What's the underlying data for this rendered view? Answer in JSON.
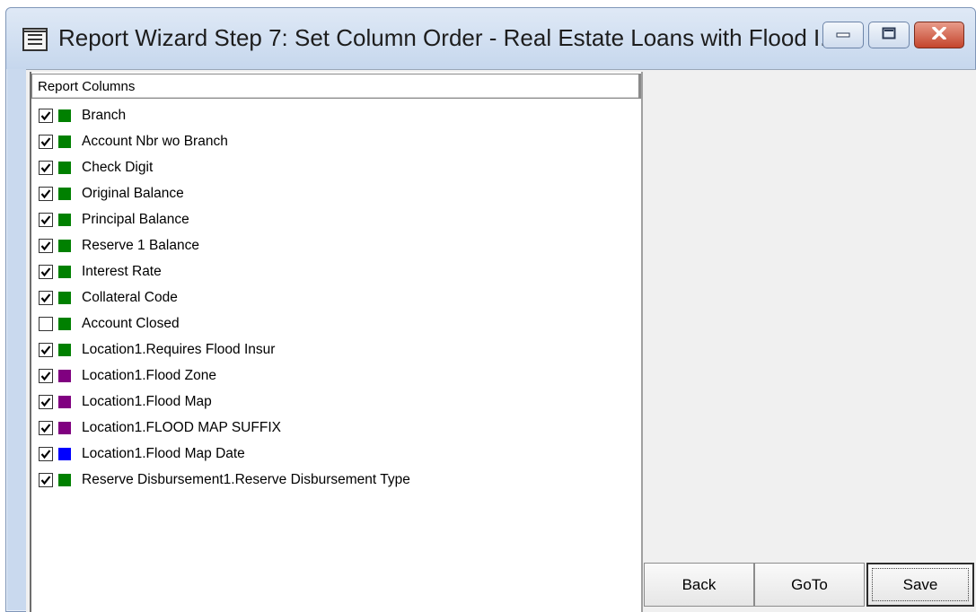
{
  "window": {
    "title": "Report Wizard Step 7:  Set Column Order - Real Estate Loans with Flood I..."
  },
  "list": {
    "header": "Report Columns",
    "items": [
      {
        "label": "Branch",
        "checked": true,
        "color": "#008000"
      },
      {
        "label": "Account Nbr wo Branch",
        "checked": true,
        "color": "#008000"
      },
      {
        "label": "Check Digit",
        "checked": true,
        "color": "#008000"
      },
      {
        "label": "Original Balance",
        "checked": true,
        "color": "#008000"
      },
      {
        "label": "Principal Balance",
        "checked": true,
        "color": "#008000"
      },
      {
        "label": "Reserve 1 Balance",
        "checked": true,
        "color": "#008000"
      },
      {
        "label": "Interest Rate",
        "checked": true,
        "color": "#008000"
      },
      {
        "label": "Collateral Code",
        "checked": true,
        "color": "#008000"
      },
      {
        "label": "Account Closed",
        "checked": false,
        "color": "#008000"
      },
      {
        "label": "Location1.Requires Flood Insur",
        "checked": true,
        "color": "#008000"
      },
      {
        "label": "Location1.Flood Zone",
        "checked": true,
        "color": "#800080"
      },
      {
        "label": "Location1.Flood Map",
        "checked": true,
        "color": "#800080"
      },
      {
        "label": "Location1.FLOOD MAP SUFFIX",
        "checked": true,
        "color": "#800080"
      },
      {
        "label": "Location1.Flood Map Date",
        "checked": true,
        "color": "#0000ff"
      },
      {
        "label": "Reserve Disbursement1.Reserve Disbursement Type",
        "checked": true,
        "color": "#008000"
      }
    ]
  },
  "buttons": {
    "back": "Back",
    "goto": "GoTo",
    "save": "Save"
  }
}
